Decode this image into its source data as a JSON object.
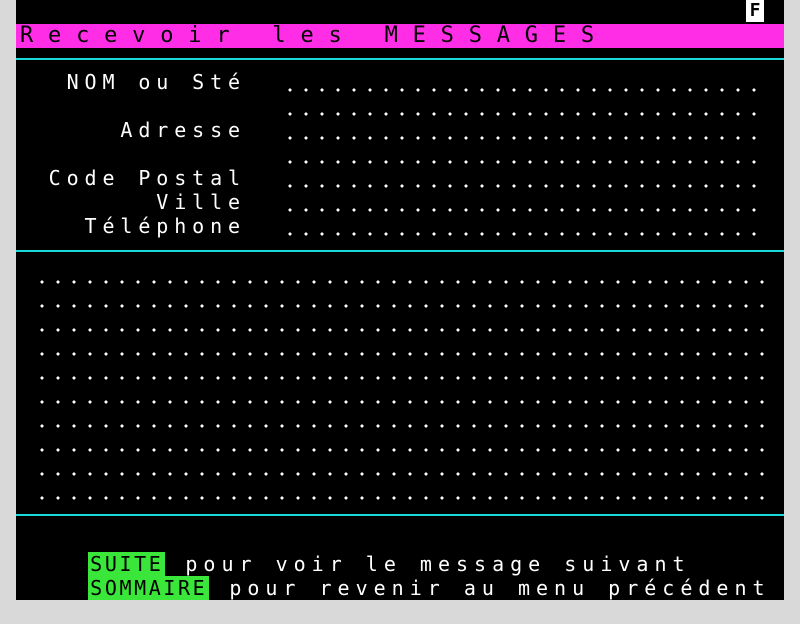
{
  "header": {
    "status_letter": "F",
    "title": "Recevoir les MESSAGES"
  },
  "form": {
    "fields": [
      {
        "label": "NOM ou Sté",
        "value": ""
      },
      {
        "label": "Adresse",
        "value": ""
      },
      {
        "label": "Code Postal",
        "value": ""
      },
      {
        "label": "Ville",
        "value": ""
      },
      {
        "label": "Téléphone",
        "value": ""
      }
    ]
  },
  "message": {
    "body": ""
  },
  "footer": {
    "suite_key": "SUITE",
    "suite_text": "pour voir le message suivant",
    "sommaire_key": "SOMMAIRE",
    "sommaire_text": "pour revenir au menu précédent"
  },
  "colors": {
    "background": "#000000",
    "title_bar": "#ff2ee6",
    "rule": "#19d9d9",
    "key_highlight": "#39e639",
    "text": "#ffffff"
  }
}
